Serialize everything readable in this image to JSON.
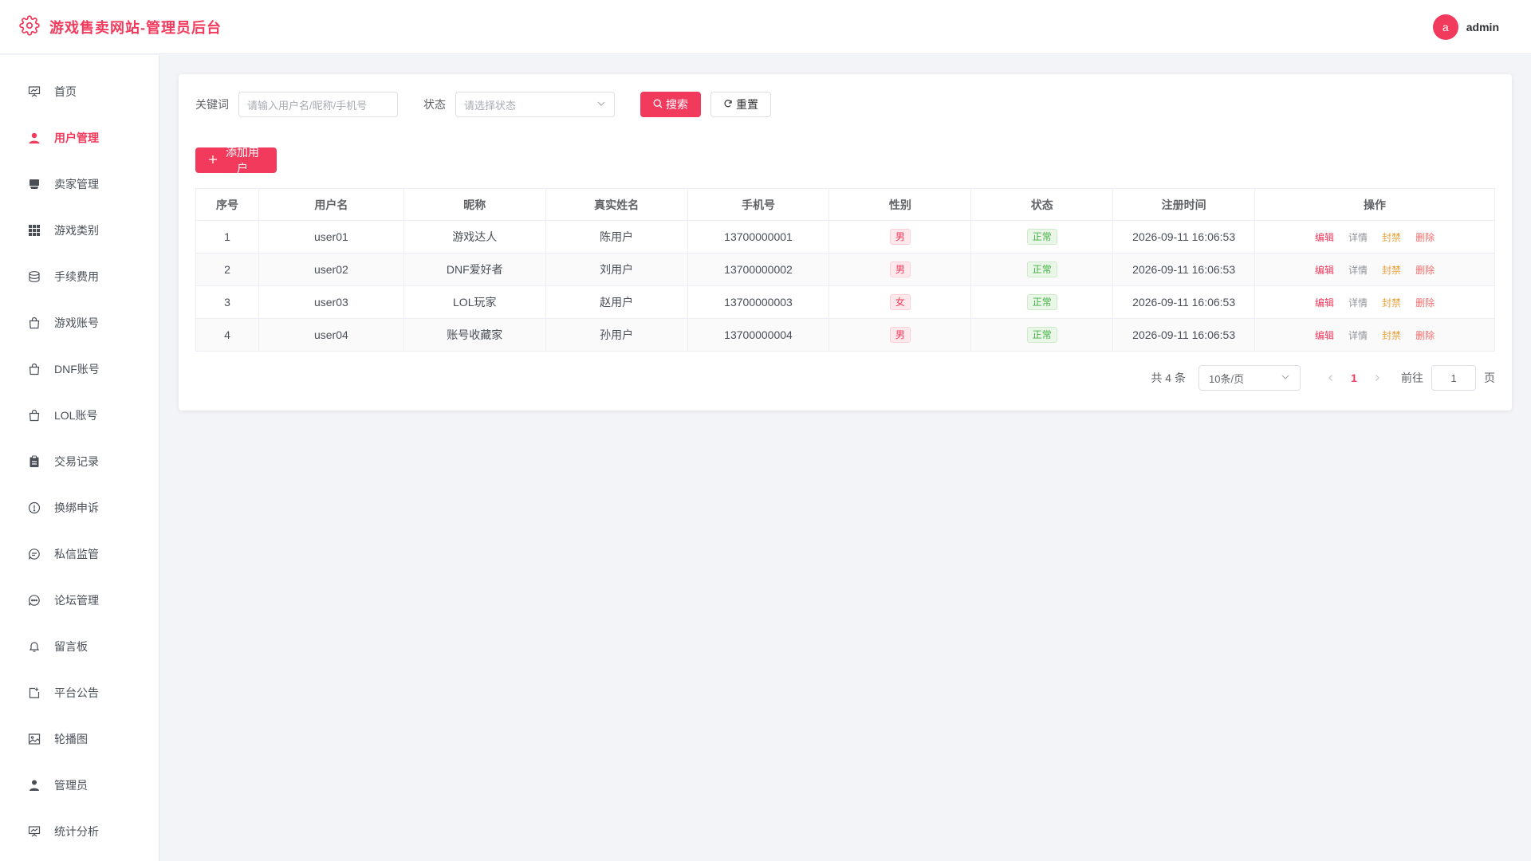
{
  "app": {
    "title": "游戏售卖网站-管理员后台",
    "user": {
      "avatar_letter": "a",
      "name": "admin"
    },
    "accent_color": "#f23a5d"
  },
  "sidebar": {
    "items": [
      {
        "label": "首页",
        "icon": "presentation-icon",
        "active": false
      },
      {
        "label": "用户管理",
        "icon": "user-icon",
        "active": true
      },
      {
        "label": "卖家管理",
        "icon": "seller-icon",
        "active": false
      },
      {
        "label": "游戏类别",
        "icon": "grid-icon",
        "active": false
      },
      {
        "label": "手续费用",
        "icon": "coins-icon",
        "active": false
      },
      {
        "label": "游戏账号",
        "icon": "bag-icon",
        "active": false
      },
      {
        "label": "DNF账号",
        "icon": "bag-icon",
        "active": false
      },
      {
        "label": "LOL账号",
        "icon": "bag-icon",
        "active": false
      },
      {
        "label": "交易记录",
        "icon": "clipboard-icon",
        "active": false
      },
      {
        "label": "换绑申诉",
        "icon": "warning-circle-icon",
        "active": false
      },
      {
        "label": "私信监管",
        "icon": "chat-icon",
        "active": false
      },
      {
        "label": "论坛管理",
        "icon": "chat-dots-icon",
        "active": false
      },
      {
        "label": "留言板",
        "icon": "bell-icon",
        "active": false
      },
      {
        "label": "平台公告",
        "icon": "notice-icon",
        "active": false
      },
      {
        "label": "轮播图",
        "icon": "picture-icon",
        "active": false
      },
      {
        "label": "管理员",
        "icon": "admin-icon",
        "active": false
      },
      {
        "label": "统计分析",
        "icon": "presentation-icon",
        "active": false
      }
    ]
  },
  "filter": {
    "keyword_label": "关键词",
    "keyword_placeholder": "请输入用户名/昵称/手机号",
    "status_label": "状态",
    "status_placeholder": "请选择状态",
    "search_label": "搜索",
    "reset_label": "重置"
  },
  "add_user_label": "添加用户",
  "table": {
    "headers": [
      "序号",
      "用户名",
      "昵称",
      "真实姓名",
      "手机号",
      "性别",
      "状态",
      "注册时间",
      "操作"
    ],
    "rows": [
      {
        "no": "1",
        "username": "user01",
        "nickname": "游戏达人",
        "realname": "陈用户",
        "phone": "13700000001",
        "gender": "男",
        "status": "正常",
        "reg_time": "2026-09-11 16:06:53"
      },
      {
        "no": "2",
        "username": "user02",
        "nickname": "DNF爱好者",
        "realname": "刘用户",
        "phone": "13700000002",
        "gender": "男",
        "status": "正常",
        "reg_time": "2026-09-11 16:06:53"
      },
      {
        "no": "3",
        "username": "user03",
        "nickname": "LOL玩家",
        "realname": "赵用户",
        "phone": "13700000003",
        "gender": "女",
        "status": "正常",
        "reg_time": "2026-09-11 16:06:53"
      },
      {
        "no": "4",
        "username": "user04",
        "nickname": "账号收藏家",
        "realname": "孙用户",
        "phone": "13700000004",
        "gender": "男",
        "status": "正常",
        "reg_time": "2026-09-11 16:06:53"
      }
    ],
    "ops": {
      "edit": "编辑",
      "detail": "详情",
      "ban": "封禁",
      "delete": "删除"
    }
  },
  "pagination": {
    "total_text": "共 4 条",
    "page_size": "10条/页",
    "current_page": "1",
    "goto_label": "前往",
    "goto_value": "1",
    "page_suffix": "页"
  }
}
